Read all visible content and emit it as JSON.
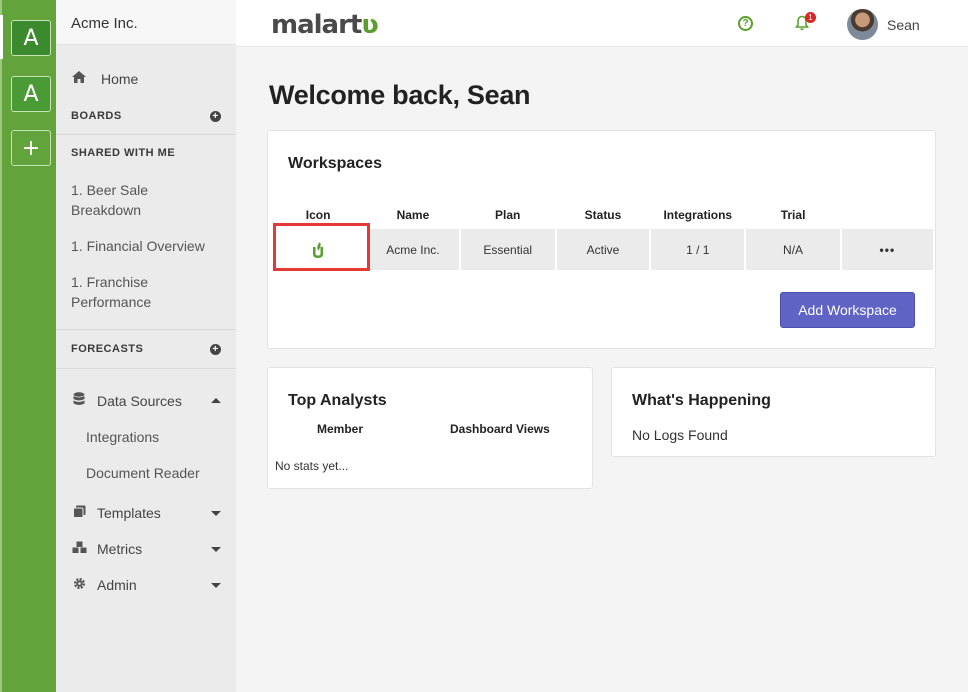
{
  "rail": {
    "items": [
      "A",
      "A",
      "+"
    ]
  },
  "sidebar": {
    "org_name": "Acme Inc.",
    "home": "Home",
    "boards": "BOARDS",
    "shared_with_me": "SHARED WITH ME",
    "shared_items": [
      "1. Beer Sale Breakdown",
      "1. Financial Overview",
      "1. Franchise Performance"
    ],
    "forecasts": "FORECASTS",
    "data_sources": "Data Sources",
    "data_sources_children": [
      "Integrations",
      "Document Reader"
    ],
    "templates": "Templates",
    "metrics": "Metrics",
    "admin": "Admin"
  },
  "topbar": {
    "logo_text": "malart",
    "logo_accent": "ʋ",
    "help_icon": "?",
    "notification_count": "1",
    "user_name": "Sean"
  },
  "main": {
    "title": "Welcome back, Sean",
    "workspaces": {
      "title": "Workspaces",
      "columns": [
        "Icon",
        "Name",
        "Plan",
        "Status",
        "Integrations",
        "Trial",
        ""
      ],
      "row": {
        "name": "Acme Inc.",
        "plan": "Essential",
        "status": "Active",
        "integrations": "1 / 1",
        "trial": "N/A",
        "actions": "•••"
      },
      "add_button": "Add Workspace"
    },
    "top_analysts": {
      "title": "Top Analysts",
      "col_member": "Member",
      "col_views": "Dashboard Views",
      "empty": "No stats yet..."
    },
    "whats_happening": {
      "title": "What's Happening",
      "empty": "No Logs Found"
    }
  },
  "colors": {
    "brand_green": "#62a33c",
    "primary_button": "#5e63c4",
    "highlight": "#e53935",
    "integrations_text": "#f0a04b"
  }
}
